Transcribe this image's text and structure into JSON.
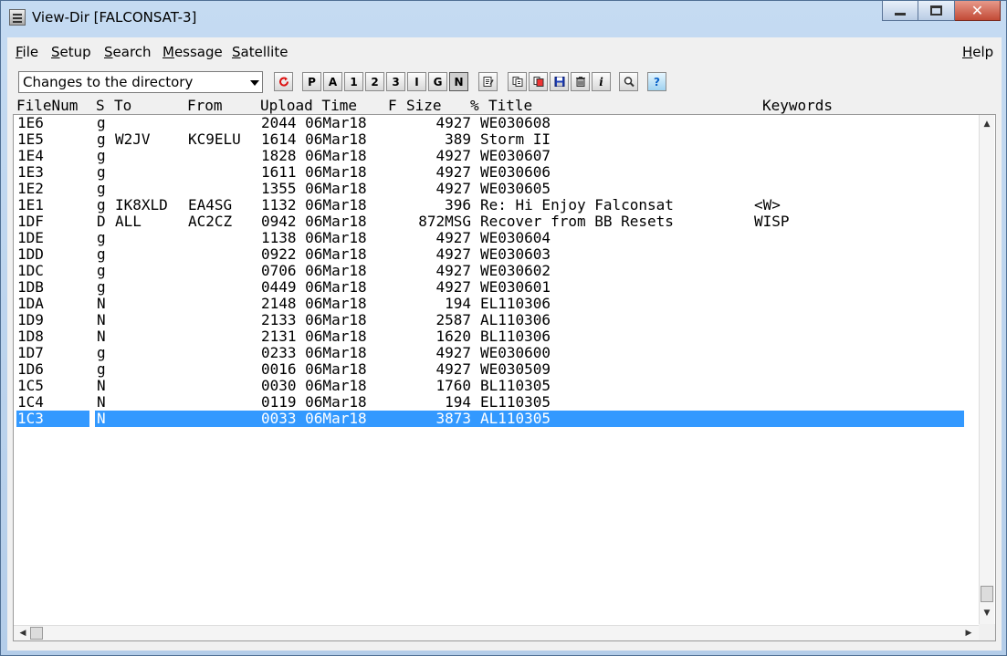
{
  "window": {
    "title": "View-Dir [FALCONSAT-3]"
  },
  "menu": {
    "file": "File",
    "setup": "Setup",
    "search": "Search",
    "message": "Message",
    "satellite": "Satellite",
    "help": "Help"
  },
  "toolbar": {
    "filter_value": "Changes to the directory",
    "letter_buttons": [
      "P",
      "A",
      "1",
      "2",
      "3",
      "I",
      "G",
      "N"
    ],
    "pressed_button": "N",
    "icons": [
      "refresh-icon",
      "edit-icon",
      "copy-icon",
      "cut-icon",
      "save-icon",
      "delete-icon",
      "info-icon",
      "find-icon",
      "help-icon"
    ]
  },
  "columns": {
    "filenum": "FileNum",
    "s": "S",
    "to": "To",
    "from": "From",
    "upload_time": "Upload Time",
    "f": "F",
    "size": "Size",
    "pct": "%",
    "title": "Title",
    "keywords": "Keywords"
  },
  "rows": [
    {
      "filenum": "1E6",
      "s": "g",
      "to": "",
      "from": "",
      "upload": "2044 06Mar18",
      "f": "",
      "size": "4927",
      "title": "WE030608",
      "keywords": ""
    },
    {
      "filenum": "1E5",
      "s": "g",
      "to": "W2JV",
      "from": "KC9ELU",
      "upload": "1614 06Mar18",
      "f": "",
      "size": "389",
      "title": "Storm II",
      "keywords": ""
    },
    {
      "filenum": "1E4",
      "s": "g",
      "to": "",
      "from": "",
      "upload": "1828 06Mar18",
      "f": "",
      "size": "4927",
      "title": "WE030607",
      "keywords": ""
    },
    {
      "filenum": "1E3",
      "s": "g",
      "to": "",
      "from": "",
      "upload": "1611 06Mar18",
      "f": "",
      "size": "4927",
      "title": "WE030606",
      "keywords": ""
    },
    {
      "filenum": "1E2",
      "s": "g",
      "to": "",
      "from": "",
      "upload": "1355 06Mar18",
      "f": "",
      "size": "4927",
      "title": "WE030605",
      "keywords": ""
    },
    {
      "filenum": "1E1",
      "s": "g",
      "to": "IK8XLD",
      "from": "EA4SG",
      "upload": "1132 06Mar18",
      "f": "",
      "size": "396",
      "title": "Re: Hi Enjoy Falconsat",
      "keywords": "<W>"
    },
    {
      "filenum": "1DF",
      "s": "D",
      "to": "ALL",
      "from": "AC2CZ",
      "upload": "0942 06Mar18",
      "f": "",
      "size": "872MSG",
      "title": "Recover from BB Resets",
      "keywords": "WISP"
    },
    {
      "filenum": "1DE",
      "s": "g",
      "to": "",
      "from": "",
      "upload": "1138 06Mar18",
      "f": "",
      "size": "4927",
      "title": "WE030604",
      "keywords": ""
    },
    {
      "filenum": "1DD",
      "s": "g",
      "to": "",
      "from": "",
      "upload": "0922 06Mar18",
      "f": "",
      "size": "4927",
      "title": "WE030603",
      "keywords": ""
    },
    {
      "filenum": "1DC",
      "s": "g",
      "to": "",
      "from": "",
      "upload": "0706 06Mar18",
      "f": "",
      "size": "4927",
      "title": "WE030602",
      "keywords": ""
    },
    {
      "filenum": "1DB",
      "s": "g",
      "to": "",
      "from": "",
      "upload": "0449 06Mar18",
      "f": "",
      "size": "4927",
      "title": "WE030601",
      "keywords": ""
    },
    {
      "filenum": "1DA",
      "s": "N",
      "to": "",
      "from": "",
      "upload": "2148 06Mar18",
      "f": "",
      "size": "194",
      "title": "EL110306",
      "keywords": ""
    },
    {
      "filenum": "1D9",
      "s": "N",
      "to": "",
      "from": "",
      "upload": "2133 06Mar18",
      "f": "",
      "size": "2587",
      "title": "AL110306",
      "keywords": ""
    },
    {
      "filenum": "1D8",
      "s": "N",
      "to": "",
      "from": "",
      "upload": "2131 06Mar18",
      "f": "",
      "size": "1620",
      "title": "BL110306",
      "keywords": ""
    },
    {
      "filenum": "1D7",
      "s": "g",
      "to": "",
      "from": "",
      "upload": "0233 06Mar18",
      "f": "",
      "size": "4927",
      "title": "WE030600",
      "keywords": ""
    },
    {
      "filenum": "1D6",
      "s": "g",
      "to": "",
      "from": "",
      "upload": "0016 06Mar18",
      "f": "",
      "size": "4927",
      "title": "WE030509",
      "keywords": ""
    },
    {
      "filenum": "1C5",
      "s": "N",
      "to": "",
      "from": "",
      "upload": "0030 06Mar18",
      "f": "",
      "size": "1760",
      "title": "BL110305",
      "keywords": ""
    },
    {
      "filenum": "1C4",
      "s": "N",
      "to": "",
      "from": "",
      "upload": "0119 06Mar18",
      "f": "",
      "size": "194",
      "title": "EL110305",
      "keywords": ""
    },
    {
      "filenum": "1C3",
      "s": "N",
      "to": "",
      "from": "",
      "upload": "0033 06Mar18",
      "f": "",
      "size": "3873",
      "title": "AL110305",
      "keywords": ""
    }
  ],
  "selected_row": 18,
  "colors": {
    "selection": "#3399ff",
    "close_button": "#c24a36"
  }
}
